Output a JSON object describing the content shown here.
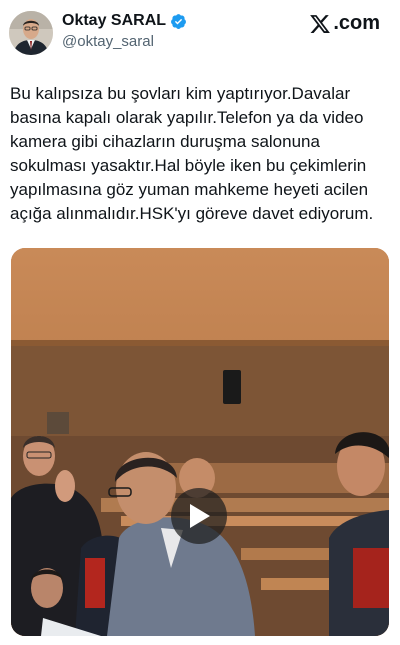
{
  "author": {
    "name": "Oktay SARAL",
    "handle": "@oktay_saral",
    "verified": true,
    "avatar_icon": "profile-photo"
  },
  "platform": {
    "logo_text": ".com",
    "logo_icon": "x-logo-icon"
  },
  "tweet": {
    "text": "Bu kalıpsıza bu şovları kim yaptırıyor.Davalar basına kapalı olarak yapılır.Telefon ya da video kamera gibi cihazların duruşma salonuna sokulması yasaktır.Hal böyle iken bu çekimlerin yapılmasına göz yuman mahkeme heyeti acilen açığa alınmalıdır.HSK'yı göreve davet ediyorum."
  },
  "media": {
    "type": "video",
    "play_icon": "play-icon"
  },
  "colors": {
    "verified": "#1d9bf0",
    "handle": "#536471",
    "text": "#0f1419"
  }
}
